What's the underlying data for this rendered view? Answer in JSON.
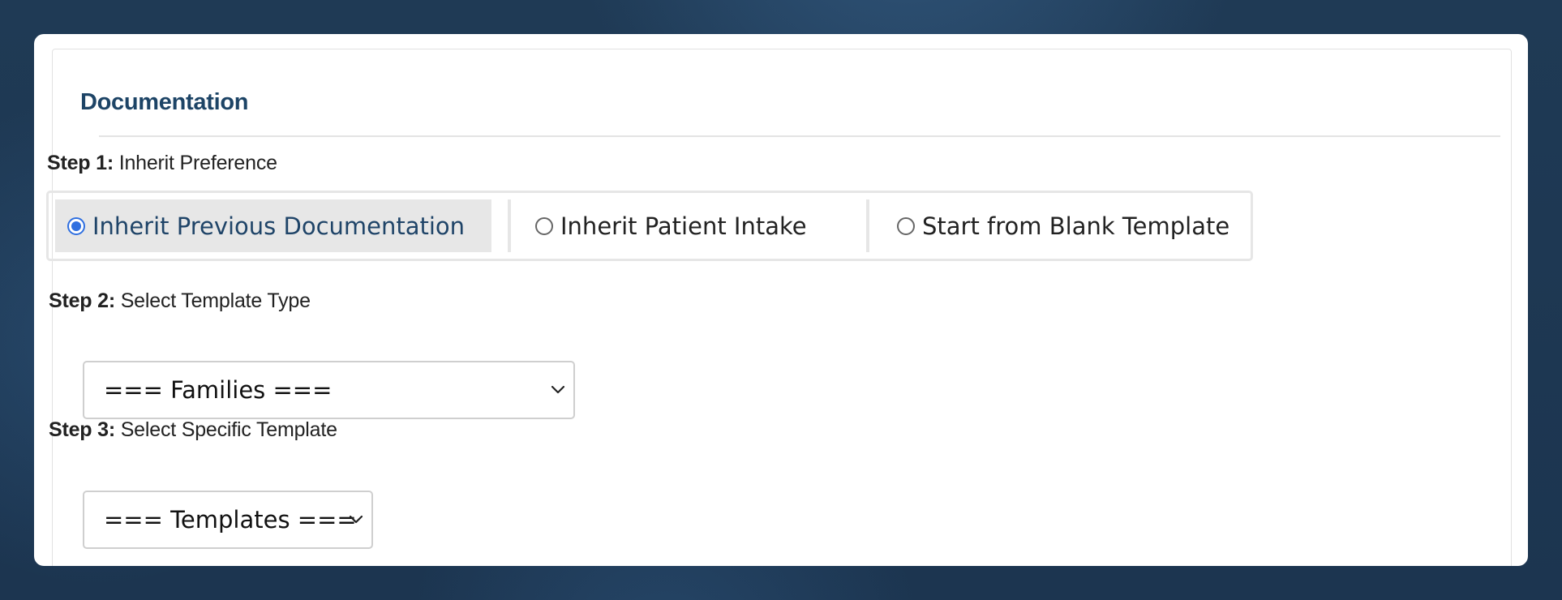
{
  "panel": {
    "title": "Documentation"
  },
  "step1": {
    "prefix": "Step 1:",
    "text": "Inherit Preference",
    "options": [
      {
        "label": "Inherit Previous Documentation",
        "selected": true
      },
      {
        "label": "Inherit Patient Intake",
        "selected": false
      },
      {
        "label": "Start from Blank Template",
        "selected": false
      }
    ]
  },
  "step2": {
    "prefix": "Step 2:",
    "text": "Select Template Type",
    "select_value": "=== Families ==="
  },
  "step3": {
    "prefix": "Step 3:",
    "text": "Select Specific Template",
    "select_value": "=== Templates ==="
  },
  "colors": {
    "background": "#1f3a55",
    "title": "#1d4466",
    "radio_accent": "#2f6fe0",
    "selected_bg": "#e7e7e7"
  },
  "icons": {
    "select_chevron": "chevron-down-icon",
    "radio": "radio-button-icon"
  }
}
